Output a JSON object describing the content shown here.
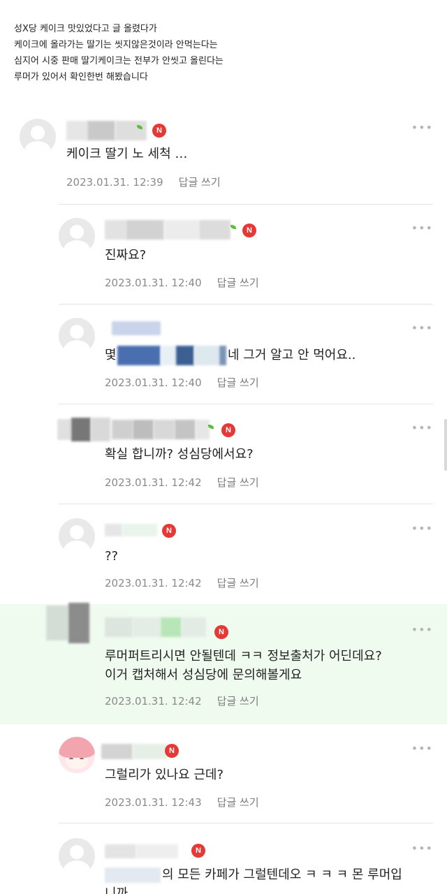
{
  "intro": {
    "lines": [
      "성X당 케이크 맛있었다고 글 올렸다가",
      "케이크에 올라가는 딸기는 씻지않은것이라 안먹는다는",
      "심지어 시중 판매 딸기케이크는 전부가 안씻고 올린다는",
      "루머가 있어서 확인한번 해봤습니다"
    ]
  },
  "badge": "N",
  "more_label": "•••",
  "comments": [
    {
      "text": "케이크 딸기 노 세척 …",
      "date": "2023.01.31. 12:39",
      "reply": "답글 쓰기"
    },
    {
      "text": "진짜요?",
      "date": "2023.01.31. 12:40",
      "reply": "답글 쓰기"
    },
    {
      "prefix": "몇",
      "text": "네 그거 알고 안 먹어요..",
      "date": "2023.01.31. 12:40",
      "reply": "답글 쓰기"
    },
    {
      "text": "확실 합니까? 성심당에서요?",
      "date": "2023.01.31. 12:42",
      "reply": "답글 쓰기"
    },
    {
      "text": "??",
      "date": "2023.01.31. 12:42",
      "reply": "답글 쓰기"
    },
    {
      "text_lines": [
        "루머퍼트리시면 안될텐데 ㅋㅋ 정보출처가 어딘데요?",
        "이거 캡처해서 성심당에 문의해볼게요"
      ],
      "date": "2023.01.31. 12:42",
      "reply": "답글 쓰기"
    },
    {
      "text": "그럴리가 있나요 근데?",
      "date": "2023.01.31. 12:43",
      "reply": "답글 쓰기"
    },
    {
      "text_lines": [
        "의 모든 카페가 그럴텐데오 ㅋ ㅋ ㅋ 몬 루머입",
        "니까"
      ]
    }
  ],
  "colors": {
    "badge": "#e53935",
    "highlight": "#f0fbef",
    "meta": "#8a8a8a",
    "divider": "#e4e4e4"
  }
}
